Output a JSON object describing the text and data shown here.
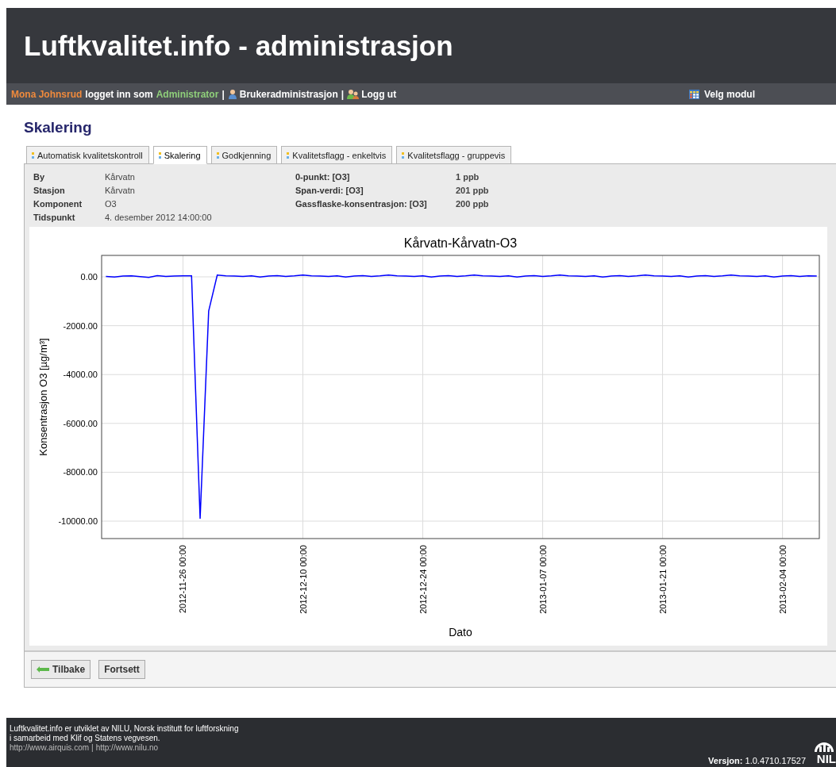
{
  "header": {
    "title": "Luftkvalitet.info - administrasjon"
  },
  "user_bar": {
    "user_name": "Mona Johnsrud",
    "logged_in_text": "logget inn som",
    "role": "Administrator",
    "links": [
      {
        "label": "Brukeradministrasjon",
        "kind": "users"
      },
      {
        "label": "Logg ut",
        "kind": "logout"
      }
    ],
    "separator": "|",
    "module_button": "Velg modul"
  },
  "page_title": "Skalering",
  "tabs": [
    {
      "label": "Automatisk kvalitetskontroll",
      "selected": false
    },
    {
      "label": "Skalering",
      "selected": true
    },
    {
      "label": "Godkjenning",
      "selected": false
    },
    {
      "label": "Kvalitetsflagg - enkeltvis",
      "selected": false
    },
    {
      "label": "Kvalitetsflagg - gruppevis",
      "selected": false
    }
  ],
  "info_left": [
    {
      "label": "By",
      "value": "Kårvatn"
    },
    {
      "label": "Stasjon",
      "value": "Kårvatn"
    },
    {
      "label": "Komponent",
      "value": "O3"
    },
    {
      "label": "Tidspunkt",
      "value": "4. desember 2012 14:00:00"
    }
  ],
  "info_right": [
    {
      "label": "0-punkt: [O3]",
      "value": "1 ppb"
    },
    {
      "label": "Span-verdi: [O3]",
      "value": "201 ppb"
    },
    {
      "label": "Gassflaske-konsentrasjon: [O3]",
      "value": "200 ppb"
    }
  ],
  "chart_data": {
    "type": "line",
    "title": "Kårvatn-Kårvatn-O3",
    "xlabel": "Dato",
    "ylabel": "Konsentrasjon O3 [µg/m³]",
    "categories": [
      null,
      null,
      null,
      null,
      null,
      null,
      null,
      null,
      null,
      "2012-11-26 00:00",
      null,
      null,
      null,
      null,
      null,
      null,
      null,
      null,
      null,
      null,
      null,
      null,
      null,
      "2012-12-10 00:00",
      null,
      null,
      null,
      null,
      null,
      null,
      null,
      null,
      null,
      null,
      null,
      null,
      null,
      "2012-12-24 00:00",
      null,
      null,
      null,
      null,
      null,
      null,
      null,
      null,
      null,
      null,
      null,
      null,
      null,
      "2013-01-07 00:00",
      null,
      null,
      null,
      null,
      null,
      null,
      null,
      null,
      null,
      null,
      null,
      null,
      null,
      "2013-01-21 00:00",
      null,
      null,
      null,
      null,
      null,
      null,
      null,
      null,
      null,
      null,
      null,
      null,
      null,
      "2013-02-04 00:00",
      null,
      null,
      null,
      null
    ],
    "series": [
      {
        "color": "#0000ff",
        "values": [
          20,
          -10,
          30,
          40,
          10,
          -20,
          50,
          20,
          30,
          40,
          40,
          -9900,
          -1400,
          70,
          40,
          30,
          20,
          40,
          -10,
          30,
          50,
          20,
          40,
          70,
          40,
          30,
          20,
          40,
          -10,
          30,
          50,
          20,
          40,
          70,
          40,
          30,
          20,
          40,
          -10,
          30,
          50,
          20,
          40,
          70,
          40,
          30,
          20,
          40,
          -10,
          30,
          50,
          20,
          40,
          70,
          40,
          30,
          20,
          40,
          -10,
          30,
          50,
          20,
          40,
          70,
          40,
          30,
          20,
          40,
          -10,
          30,
          50,
          20,
          40,
          70,
          40,
          30,
          20,
          40,
          -10,
          30,
          50,
          20,
          40,
          30
        ]
      }
    ],
    "ylim": [
      -10714,
      877
    ],
    "grid": true,
    "yticks": [
      {
        "value": 0,
        "label": "0.00"
      },
      {
        "value": -2000,
        "label": "-2000.00"
      },
      {
        "value": -4000,
        "label": "-4000.00"
      },
      {
        "value": -6000,
        "label": "-6000.00"
      },
      {
        "value": -8000,
        "label": "-8000.00"
      },
      {
        "value": -10000,
        "label": "-10000.00"
      }
    ]
  },
  "buttons": [
    {
      "label": "Tilbake",
      "kind": "back"
    },
    {
      "label": "Fortsett",
      "kind": "plain"
    }
  ],
  "footer": {
    "lines": [
      "Luftkvalitet.info er utviklet av NILU, Norsk institutt for luftforskning",
      "i samarbeid med Klif og Statens vegvesen."
    ],
    "links": [
      "http://www.airquis.com",
      "http://www.nilu.no"
    ],
    "link_separator": "|",
    "version_label": "Versjon:",
    "version": "1.0.4710.17527",
    "logo_text": "NIL"
  }
}
